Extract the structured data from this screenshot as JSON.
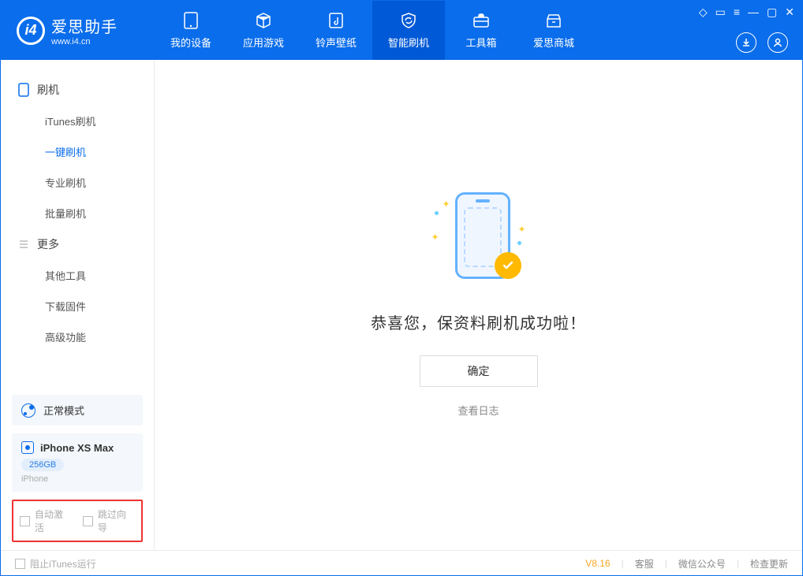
{
  "logo": {
    "title": "爱思助手",
    "subtitle": "www.i4.cn"
  },
  "nav": {
    "my_device": "我的设备",
    "apps_games": "应用游戏",
    "ringtones": "铃声壁纸",
    "smart_flash": "智能刷机",
    "toolbox": "工具箱",
    "store": "爱思商城"
  },
  "sidebar": {
    "group_flash": "刷机",
    "items_flash": [
      "iTunes刷机",
      "一键刷机",
      "专业刷机",
      "批量刷机"
    ],
    "group_more": "更多",
    "items_more": [
      "其他工具",
      "下载固件",
      "高级功能"
    ]
  },
  "mode": {
    "label": "正常模式"
  },
  "device": {
    "name": "iPhone XS Max",
    "storage": "256GB",
    "type": "iPhone"
  },
  "options": {
    "auto_activate": "自动激活",
    "skip_guide": "跳过向导"
  },
  "main": {
    "success_text": "恭喜您，保资料刷机成功啦！",
    "ok_button": "确定",
    "view_log": "查看日志"
  },
  "footer": {
    "block_itunes": "阻止iTunes运行",
    "version": "V8.16",
    "support": "客服",
    "wechat": "微信公众号",
    "check_update": "检查更新"
  }
}
